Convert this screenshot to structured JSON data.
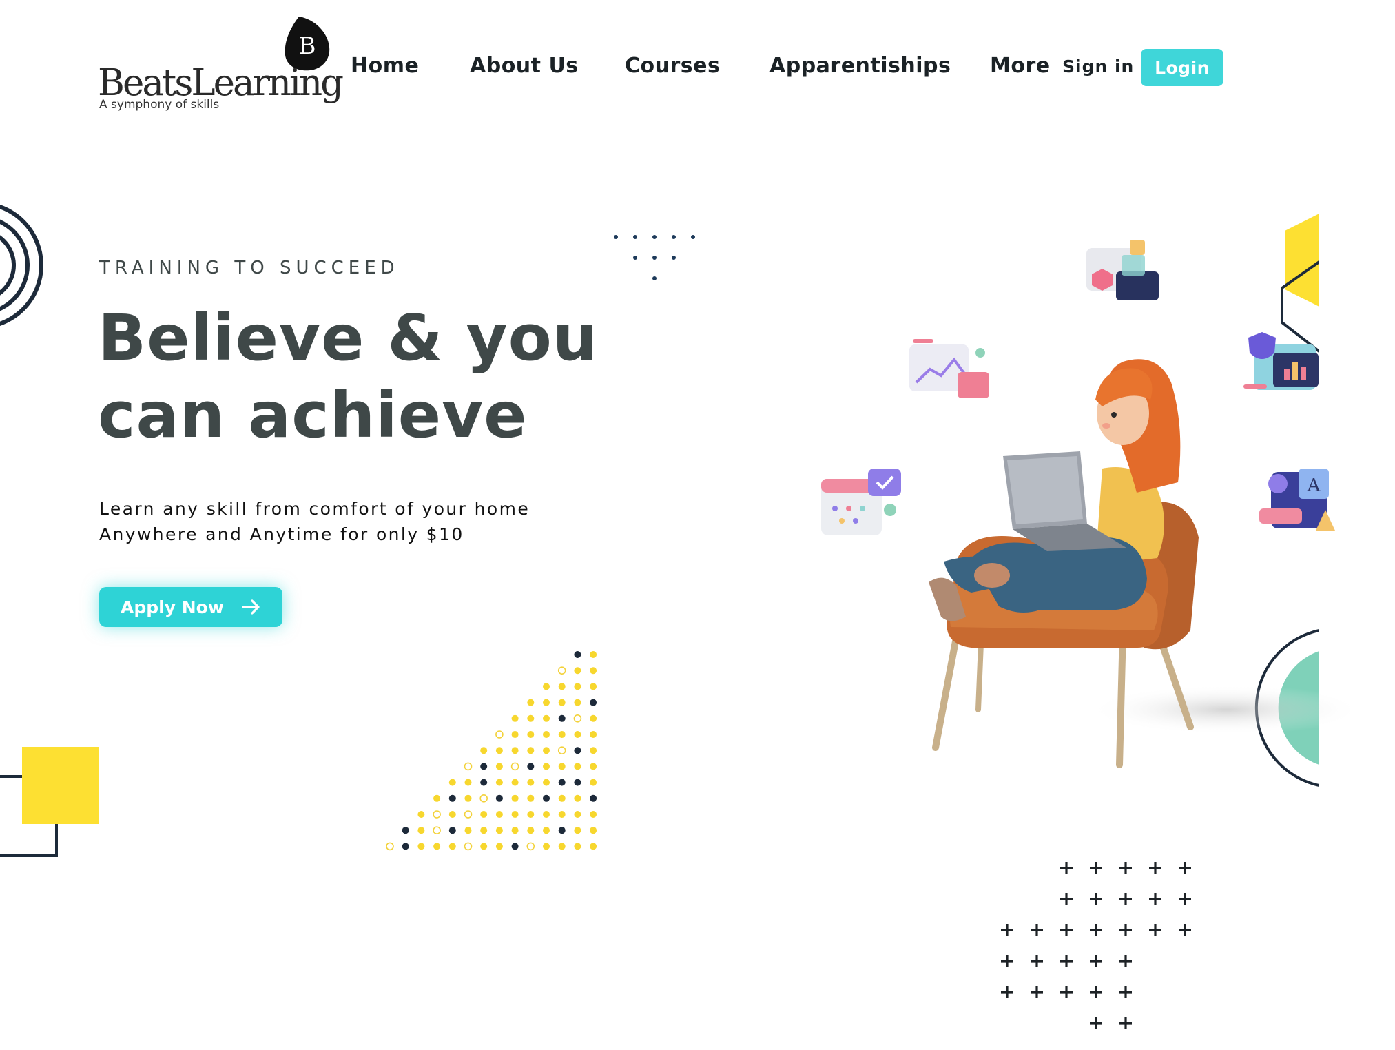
{
  "brand": {
    "name": "BeatsLearning",
    "tagline": "A symphony of skills",
    "mark_letter": "B"
  },
  "nav": {
    "items": [
      "Home",
      "About Us",
      "Courses",
      "Apparentiships",
      "More"
    ],
    "sign_in": "Sign in",
    "login": "Login"
  },
  "hero": {
    "eyebrow": "TRAINING TO SUCCEED",
    "title_line1": "Believe & you",
    "title_line2": "can achieve",
    "subtitle_line1": "Learn any skill from comfort of your home",
    "subtitle_line2": "Anywhere and Anytime for only $10",
    "cta": "Apply Now",
    "cta_icon": "arrow-right-icon"
  },
  "illustration": {
    "subject": "person-on-armchair-with-laptop",
    "floating_icons": [
      "dashboard-card-icon",
      "chart-mail-icon",
      "shield-chart-icon",
      "calendar-check-icon",
      "design-tools-icon"
    ]
  },
  "colors": {
    "accent": "#3fd6d9",
    "text_dark": "#3f4848",
    "yellow": "#fde032",
    "navy": "#1d2a3a",
    "mint": "#7fd1b9"
  }
}
